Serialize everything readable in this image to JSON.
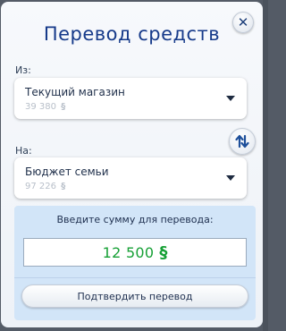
{
  "dialog": {
    "title": "Перевод средств",
    "close_icon": "close-icon"
  },
  "from": {
    "label": "Из:",
    "name": "Текущий магазин",
    "amount": "39 380",
    "currency": "§"
  },
  "swap": {
    "icon": "swap-icon"
  },
  "to": {
    "label": "На:",
    "name": "Бюджет семьи",
    "amount": "97 226",
    "currency": "§"
  },
  "transfer": {
    "prompt": "Введите сумму для перевода:",
    "value": "12 500",
    "currency": "§",
    "confirm_label": "Подтвердить перевод"
  },
  "colors": {
    "title": "#163a8a",
    "amount": "#16a035",
    "panel": "#d2e5f8",
    "muted_amount": "#b9c0ca"
  }
}
